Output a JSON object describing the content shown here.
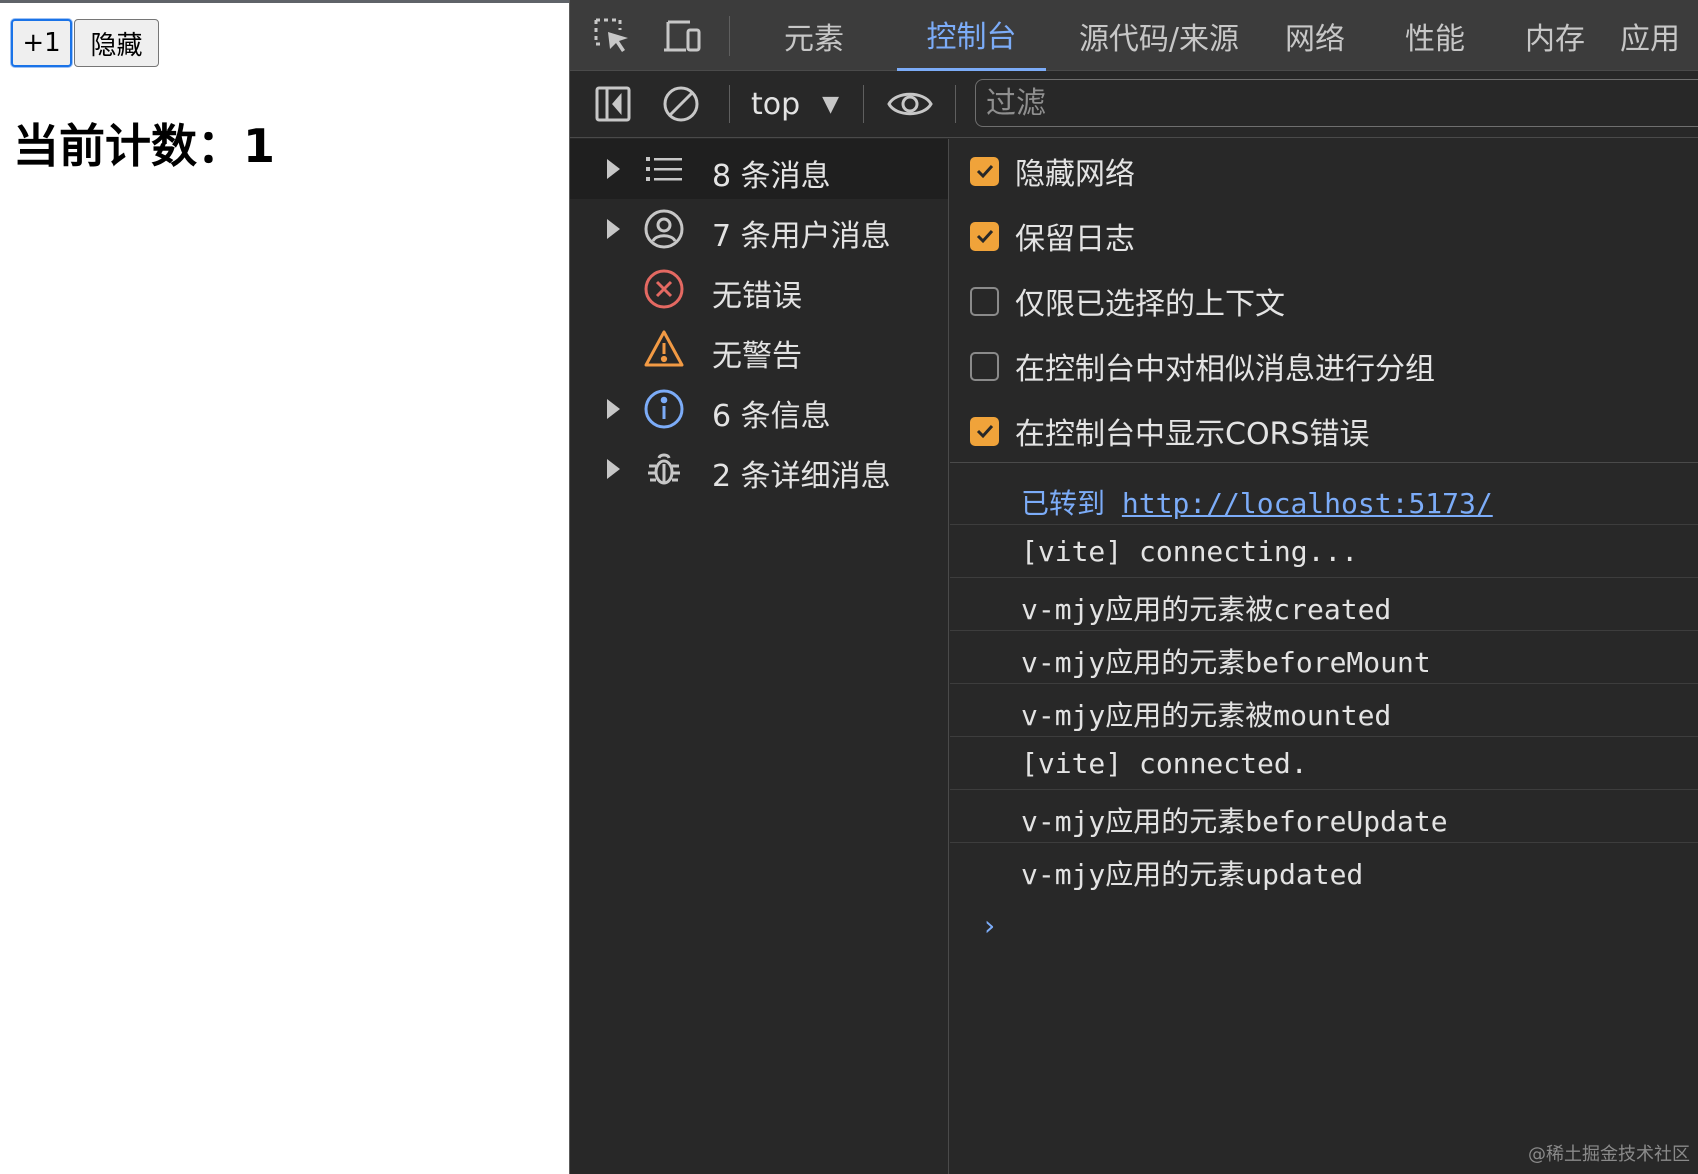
{
  "page": {
    "increment_button": "+1",
    "hide_button": "隐藏",
    "count_heading": "当前计数：1"
  },
  "devtools": {
    "tabs": [
      {
        "label": "元素",
        "active": false
      },
      {
        "label": "控制台",
        "active": true
      },
      {
        "label": "源代码/来源",
        "active": false
      },
      {
        "label": "网络",
        "active": false
      },
      {
        "label": "性能",
        "active": false
      },
      {
        "label": "内存",
        "active": false
      },
      {
        "label": "应用",
        "active": false
      }
    ],
    "toolbar": {
      "context": "top",
      "filter_placeholder": "过滤"
    },
    "sidebar": [
      {
        "label": "8 条消息",
        "icon": "list-icon",
        "expandable": true
      },
      {
        "label": "7 条用户消息",
        "icon": "user-icon",
        "expandable": true
      },
      {
        "label": "无错误",
        "icon": "error-icon",
        "expandable": false
      },
      {
        "label": "无警告",
        "icon": "warning-icon",
        "expandable": false
      },
      {
        "label": "6 条信息",
        "icon": "info-icon",
        "expandable": true
      },
      {
        "label": "2 条详细消息",
        "icon": "bug-icon",
        "expandable": true
      }
    ],
    "settings": [
      {
        "label": "隐藏网络",
        "checked": true
      },
      {
        "label": "保留日志",
        "checked": true
      },
      {
        "label": "仅限已选择的上下文",
        "checked": false
      },
      {
        "label": "在控制台中对相似消息进行分组",
        "checked": false
      },
      {
        "label": "在控制台中显示CORS错误",
        "checked": true
      }
    ],
    "navigated": {
      "prefix": "已转到",
      "url": "http://localhost:5173/"
    },
    "logs": [
      "[vite] connecting...",
      "v-mjy应用的元素被created",
      "v-mjy应用的元素beforeMount",
      "v-mjy应用的元素被mounted",
      "[vite] connected.",
      "v-mjy应用的元素beforeUpdate",
      "v-mjy应用的元素updated"
    ],
    "prompt_symbol": "›"
  },
  "watermark": "@稀土掘金技术社区",
  "colors": {
    "accent": "#7cacf8",
    "checkbox": "#f0a33a",
    "panel_bg": "#282828",
    "tabbar_bg": "#3c3c3c",
    "error": "#e46962",
    "warning": "#f29a44"
  }
}
